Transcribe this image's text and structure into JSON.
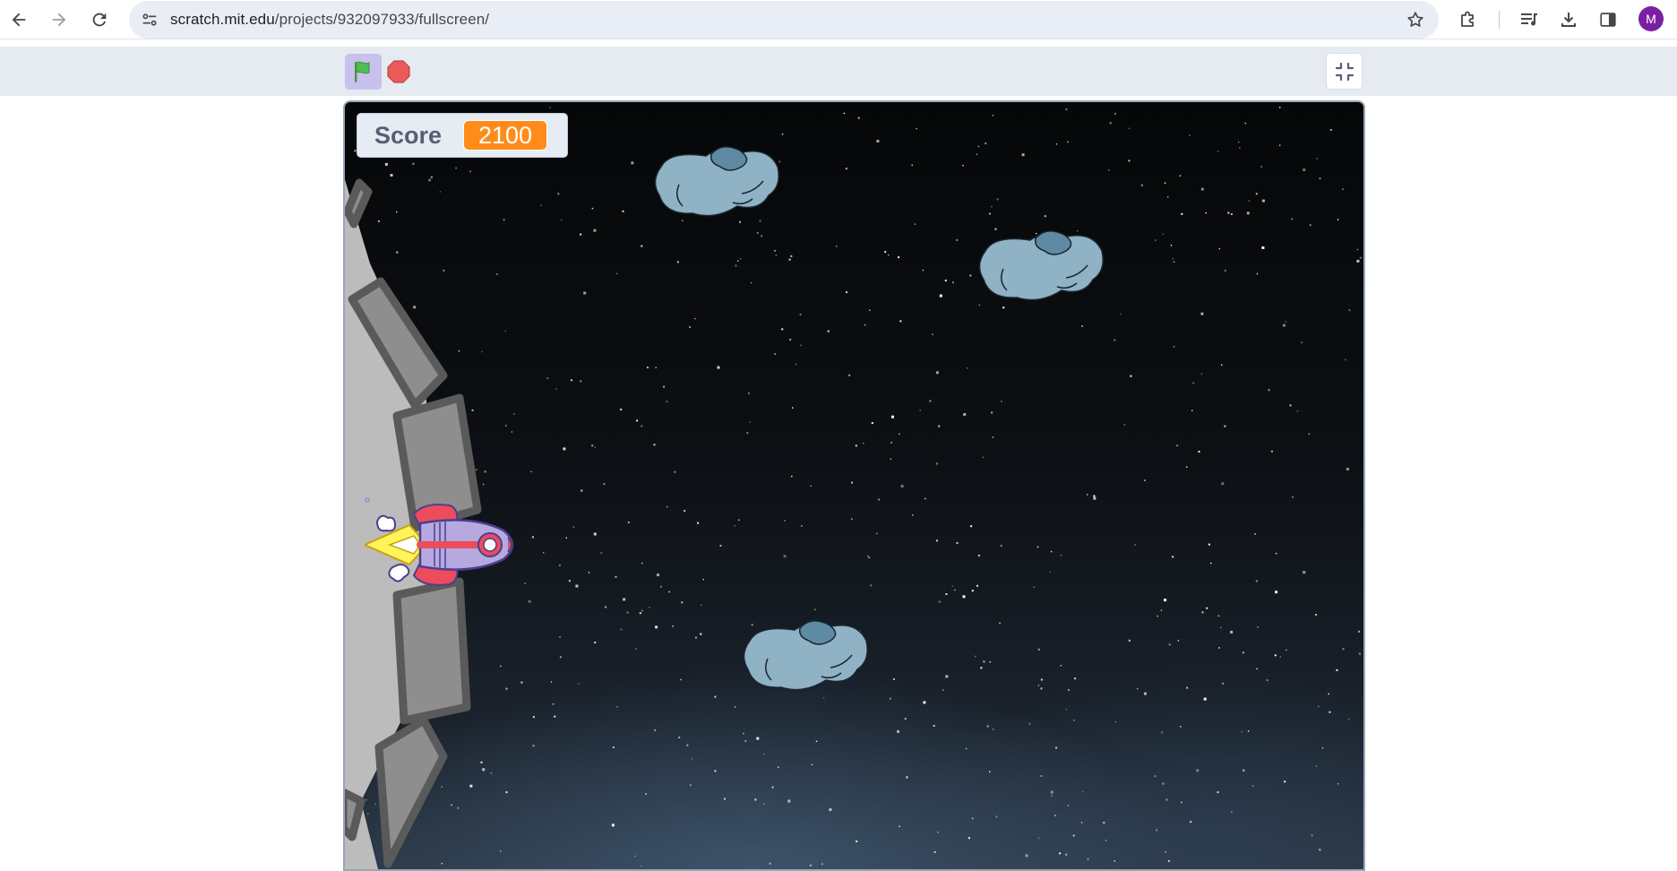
{
  "browser": {
    "url_host": "scratch.mit.edu",
    "url_path": "/projects/932097933/fullscreen/",
    "profile_initial": "M",
    "icons": [
      "back-icon",
      "forward-icon",
      "reload-icon",
      "site-info-icon",
      "bookmark-star-icon",
      "extensions-icon",
      "media-controls-icon",
      "downloads-icon",
      "side-panel-icon"
    ]
  },
  "player": {
    "controls": [
      "green-flag-icon",
      "stop-icon",
      "unfullscreen-icon"
    ],
    "colors": {
      "header_bg": "#e5ebf1",
      "flag_active_bg": "#c9c0ee",
      "stop": "#ec5959"
    }
  },
  "stage": {
    "score_label": "Score",
    "score_value": "2100",
    "colors": {
      "monitor_value_bg": "#ff8c1a",
      "asteroid": "#8fb2c4",
      "rocket_body": "#b6a9e0"
    },
    "sprites": [
      "space-station",
      "rocket-ship",
      "asteroid",
      "asteroid",
      "asteroid"
    ]
  }
}
